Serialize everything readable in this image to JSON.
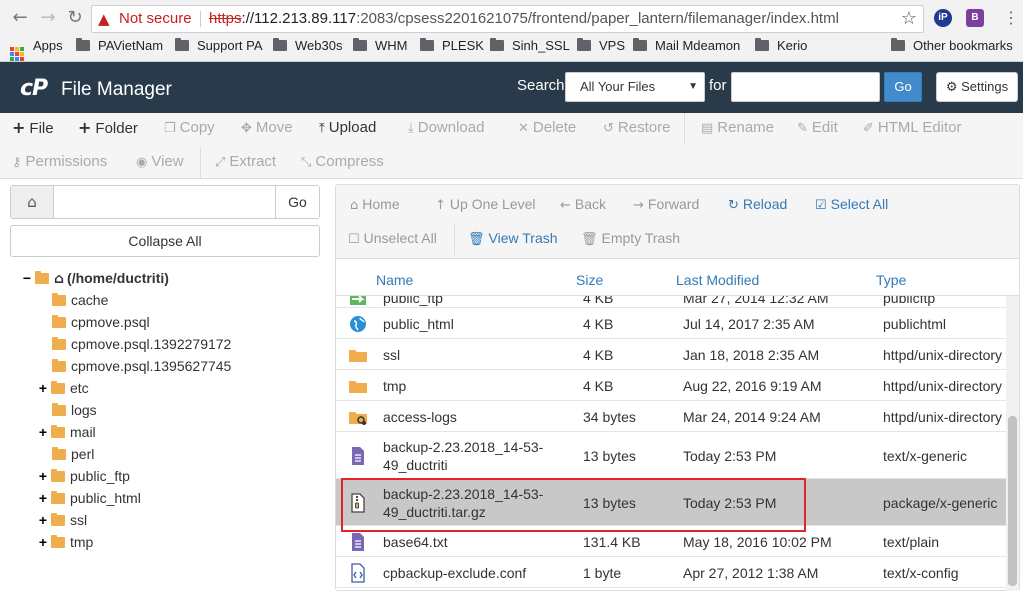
{
  "browser": {
    "security_label": "Not secure",
    "url_scheme": "https",
    "url_host": "://112.213.89.117",
    "url_rest": ":2083/cpsess2201621075/frontend/paper_lantern/filemanager/index.html",
    "ext1": "iP",
    "ext2": "B",
    "bookmarks": [
      "Apps",
      "PAVietNam",
      "Support PA",
      "Web30s",
      "WHM",
      "PLESK",
      "Sinh_SSL",
      "VPS",
      "Mail Mdeamon",
      "Kerio"
    ],
    "other_bookmarks": "Other bookmarks"
  },
  "header": {
    "logo": "cP",
    "title": "File Manager",
    "search_label": "Search",
    "search_scope": "All Your Files",
    "for_label": "for",
    "go_label": "Go",
    "settings_label": "Settings"
  },
  "toolbar": {
    "row1": [
      {
        "label": "File",
        "icon": "plus-icon",
        "enabled": true
      },
      {
        "label": "Folder",
        "icon": "plus-icon",
        "enabled": true
      },
      {
        "label": "Copy",
        "icon": "copy-icon",
        "enabled": false
      },
      {
        "label": "Move",
        "icon": "move-icon",
        "enabled": false
      },
      {
        "label": "Upload",
        "icon": "upload-icon",
        "enabled": true
      },
      {
        "label": "Download",
        "icon": "download-icon",
        "enabled": false
      },
      {
        "label": "Delete",
        "icon": "delete-icon",
        "enabled": false
      },
      {
        "label": "Restore",
        "icon": "restore-icon",
        "enabled": false
      },
      {
        "label": "Rename",
        "icon": "file-icon",
        "enabled": false
      },
      {
        "label": "Edit",
        "icon": "pencil-icon",
        "enabled": false
      },
      {
        "label": "HTML Editor",
        "icon": "edit-icon",
        "enabled": false
      }
    ],
    "row2": [
      {
        "label": "Permissions",
        "icon": "key-icon",
        "enabled": false
      },
      {
        "label": "View",
        "icon": "eye-icon",
        "enabled": false
      },
      {
        "label": "Extract",
        "icon": "expand-icon",
        "enabled": false
      },
      {
        "label": "Compress",
        "icon": "compress-icon",
        "enabled": false
      }
    ]
  },
  "left_pane": {
    "go_label": "Go",
    "path_value": "",
    "collapse_label": "Collapse All",
    "tree": [
      {
        "label": "(/home/ductriti)",
        "toggle": "−",
        "root": true
      },
      {
        "label": "cache",
        "toggle": ""
      },
      {
        "label": "cpmove.psql",
        "toggle": ""
      },
      {
        "label": "cpmove.psql.1392279172",
        "toggle": ""
      },
      {
        "label": "cpmove.psql.1395627745",
        "toggle": ""
      },
      {
        "label": "etc",
        "toggle": "+"
      },
      {
        "label": "logs",
        "toggle": ""
      },
      {
        "label": "mail",
        "toggle": "+"
      },
      {
        "label": "perl",
        "toggle": ""
      },
      {
        "label": "public_ftp",
        "toggle": "+"
      },
      {
        "label": "public_html",
        "toggle": "+"
      },
      {
        "label": "ssl",
        "toggle": "+"
      },
      {
        "label": "tmp",
        "toggle": "+"
      }
    ]
  },
  "right_pane": {
    "nav": {
      "home": "Home",
      "up": "Up One Level",
      "back": "Back",
      "forward": "Forward",
      "reload": "Reload",
      "select_all": "Select All",
      "unselect_all": "Unselect All",
      "view_trash": "View Trash",
      "empty_trash": "Empty Trash"
    },
    "columns": {
      "name": "Name",
      "size": "Size",
      "modified": "Last Modified",
      "type": "Type"
    },
    "files": [
      {
        "name": "public_ftp",
        "name2": "",
        "size": "4 KB",
        "modified": "Mar 27, 2014 12:32 AM",
        "type": "publicftp",
        "icon": "arrow-folder-icon"
      },
      {
        "name": "public_html",
        "name2": "",
        "size": "4 KB",
        "modified": "Jul 14, 2017 2:35 AM",
        "type": "publichtml",
        "icon": "globe-icon"
      },
      {
        "name": "ssl",
        "name2": "",
        "size": "4 KB",
        "modified": "Jan 18, 2018 2:35 AM",
        "type": "httpd/unix-directory",
        "icon": "folder-icon"
      },
      {
        "name": "tmp",
        "name2": "",
        "size": "4 KB",
        "modified": "Aug 22, 2016 9:19 AM",
        "type": "httpd/unix-directory",
        "icon": "folder-icon"
      },
      {
        "name": "access-logs",
        "name2": "",
        "size": "34 bytes",
        "modified": "Mar 24, 2014 9:24 AM",
        "type": "httpd/unix-directory",
        "icon": "folder-link-icon"
      },
      {
        "name": "backup-2.23.2018_14-53-",
        "name2": "49_ductriti",
        "size": "13 bytes",
        "modified": "Today 2:53 PM",
        "type": "text/x-generic",
        "icon": "text-file-icon"
      },
      {
        "name": "backup-2.23.2018_14-53-",
        "name2": "49_ductriti.tar.gz",
        "size": "13 bytes",
        "modified": "Today 2:53 PM",
        "type": "package/x-generic",
        "icon": "archive-file-icon",
        "selected": true
      },
      {
        "name": "base64.txt",
        "name2": "",
        "size": "131.4 KB",
        "modified": "May 18, 2016 10:02 PM",
        "type": "text/plain",
        "icon": "text-file-icon"
      },
      {
        "name": "cpbackup-exclude.conf",
        "name2": "",
        "size": "1 byte",
        "modified": "Apr 27, 2012 1:38 AM",
        "type": "text/x-config",
        "icon": "config-file-icon"
      }
    ]
  }
}
